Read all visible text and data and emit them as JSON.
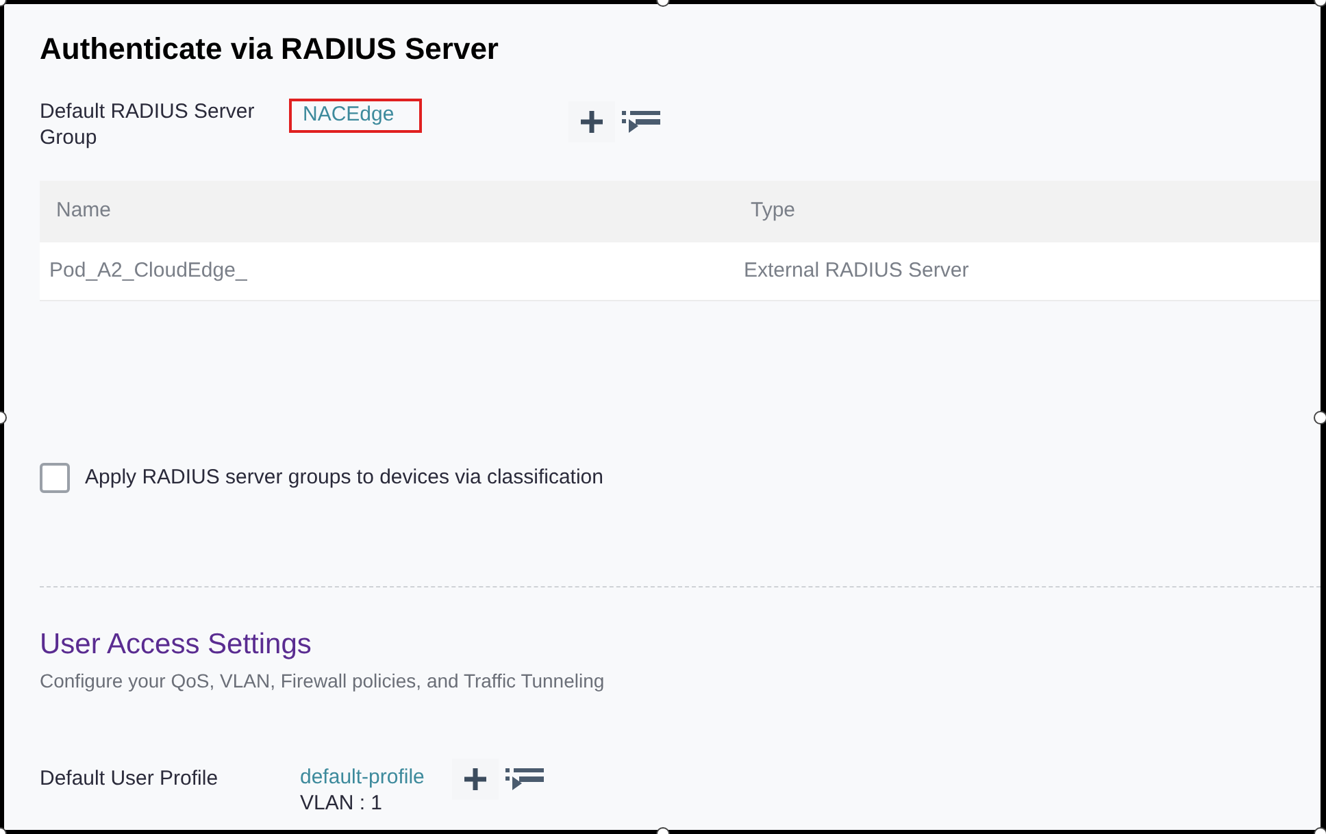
{
  "title": "Authenticate via RADIUS Server",
  "radius_group": {
    "label": "Default RADIUS Server Group",
    "value": "NACEdge",
    "highlighted": true
  },
  "table": {
    "columns": [
      "Name",
      "Type"
    ],
    "rows": [
      [
        "Pod_A2_CloudEdge_",
        "External RADIUS Server"
      ]
    ]
  },
  "classification": {
    "label": "Apply RADIUS server groups to devices via classification",
    "checked": false
  },
  "user_access": {
    "title": "User Access Settings",
    "subtitle": "Configure your QoS, VLAN, Firewall policies, and Traffic Tunneling",
    "profile_label": "Default User Profile",
    "profile_value": "default-profile",
    "vlan": "VLAN : 1"
  }
}
